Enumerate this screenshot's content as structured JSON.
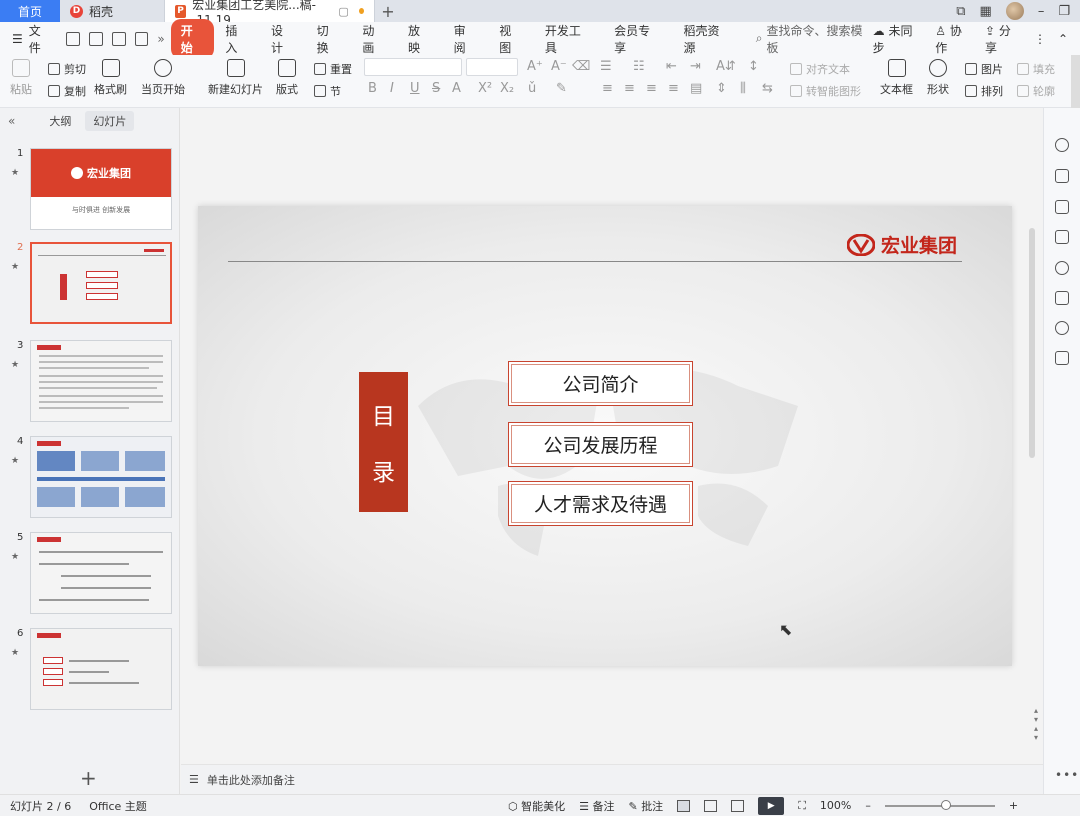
{
  "tabbar": {
    "home": "首页",
    "docer": "稻壳",
    "doc_tab": "宏业集团工艺美院...稿--11.19"
  },
  "menubar": {
    "file": "文件",
    "items": [
      "开始",
      "插入",
      "设计",
      "切换",
      "动画",
      "放映",
      "审阅",
      "视图",
      "开发工具",
      "会员专享",
      "稻壳资源"
    ],
    "search": "查找命令、搜索模板",
    "sync": "未同步",
    "collab": "协作",
    "share": "分享"
  },
  "ribbon": {
    "paste": "粘贴",
    "cut": "剪切",
    "copy": "复制",
    "format_painter": "格式刷",
    "from_current": "当页开始",
    "new_slide": "新建幻灯片",
    "layout": "版式",
    "section": "节",
    "reset": "重置",
    "align_text": "对齐文本",
    "to_smartart": "转智能图形",
    "textbox": "文本框",
    "shape": "形状",
    "picture": "图片",
    "fill": "填充",
    "arrange": "排列",
    "outline": "轮廓",
    "bold": "B",
    "italic": "I",
    "underline": "U",
    "strike": "S",
    "font_color": "A"
  },
  "left_panel": {
    "tab_outline": "大纲",
    "tab_slides": "幻灯片",
    "slide_numbers": [
      "1",
      "2",
      "3",
      "4",
      "5",
      "6"
    ],
    "thumb1_title": "宏业集团",
    "thumb1_sub": "与时俱进   创新发展"
  },
  "slide": {
    "logo_text": "宏业集团",
    "toc_title_1": "目",
    "toc_title_2": "录",
    "items": [
      "公司简介",
      "公司发展历程",
      "人才需求及待遇"
    ]
  },
  "notes": {
    "placeholder": "单击此处添加备注"
  },
  "statusbar": {
    "slide_info": "幻灯片 2 / 6",
    "theme": "Office 主题",
    "beautify": "智能美化",
    "notes": "备注",
    "comments": "批注",
    "zoom": "100%"
  },
  "colors": {
    "accent": "#e8543a",
    "brand_red": "#c3261b",
    "toc_red": "#b8361f",
    "home_tab": "#3b7df3"
  }
}
